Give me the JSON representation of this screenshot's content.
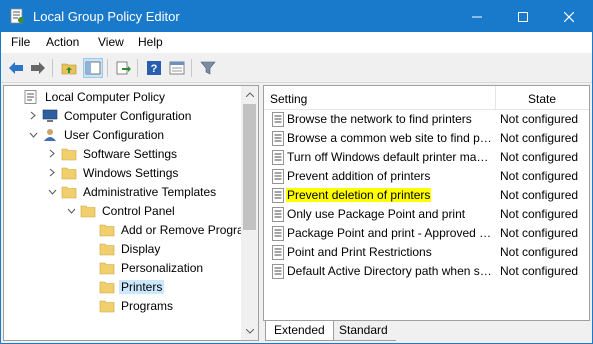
{
  "window": {
    "title": "Local Group Policy Editor"
  },
  "menu": [
    "File",
    "Action",
    "View",
    "Help"
  ],
  "tree": [
    {
      "label": "Local Computer Policy",
      "icon": "policy-icon",
      "indent": 0,
      "arrow": "none"
    },
    {
      "label": "Computer Configuration",
      "icon": "computer-icon",
      "indent": 1,
      "arrow": "collapsed"
    },
    {
      "label": "User Configuration",
      "icon": "user-icon",
      "indent": 1,
      "arrow": "expanded"
    },
    {
      "label": "Software Settings",
      "icon": "folder-icon",
      "indent": 2,
      "arrow": "collapsed"
    },
    {
      "label": "Windows Settings",
      "icon": "folder-icon",
      "indent": 2,
      "arrow": "collapsed"
    },
    {
      "label": "Administrative Templates",
      "icon": "folder-icon",
      "indent": 2,
      "arrow": "expanded"
    },
    {
      "label": "Control Panel",
      "icon": "folder-icon",
      "indent": 3,
      "arrow": "expanded"
    },
    {
      "label": "Add or Remove Programs",
      "icon": "folder-icon",
      "indent": 4,
      "arrow": "none"
    },
    {
      "label": "Display",
      "icon": "folder-icon",
      "indent": 4,
      "arrow": "none"
    },
    {
      "label": "Personalization",
      "icon": "folder-icon",
      "indent": 4,
      "arrow": "none"
    },
    {
      "label": "Printers",
      "icon": "folder-icon",
      "indent": 4,
      "arrow": "none",
      "selected": true
    },
    {
      "label": "Programs",
      "icon": "folder-icon",
      "indent": 4,
      "arrow": "none"
    }
  ],
  "list": {
    "headers": {
      "setting": "Setting",
      "state": "State"
    },
    "rows": [
      {
        "name": "Browse the network to find printers",
        "state": "Not configured"
      },
      {
        "name": "Browse a common web site to find printers",
        "state": "Not configured"
      },
      {
        "name": "Turn off Windows default printer management",
        "state": "Not configured"
      },
      {
        "name": "Prevent addition of printers",
        "state": "Not configured"
      },
      {
        "name": "Prevent deletion of printers",
        "state": "Not configured",
        "highlight": true
      },
      {
        "name": "Only use Package Point and print",
        "state": "Not configured"
      },
      {
        "name": "Package Point and print - Approved servers",
        "state": "Not configured"
      },
      {
        "name": "Point and Print Restrictions",
        "state": "Not configured"
      },
      {
        "name": "Default Active Directory path when searching for printers",
        "state": "Not configured"
      }
    ]
  },
  "tabs": {
    "extended": "Extended",
    "standard": "Standard"
  },
  "colors": {
    "titlebar": "#1979ca",
    "highlight": "#ffff00",
    "selection": "#cce8ff"
  }
}
